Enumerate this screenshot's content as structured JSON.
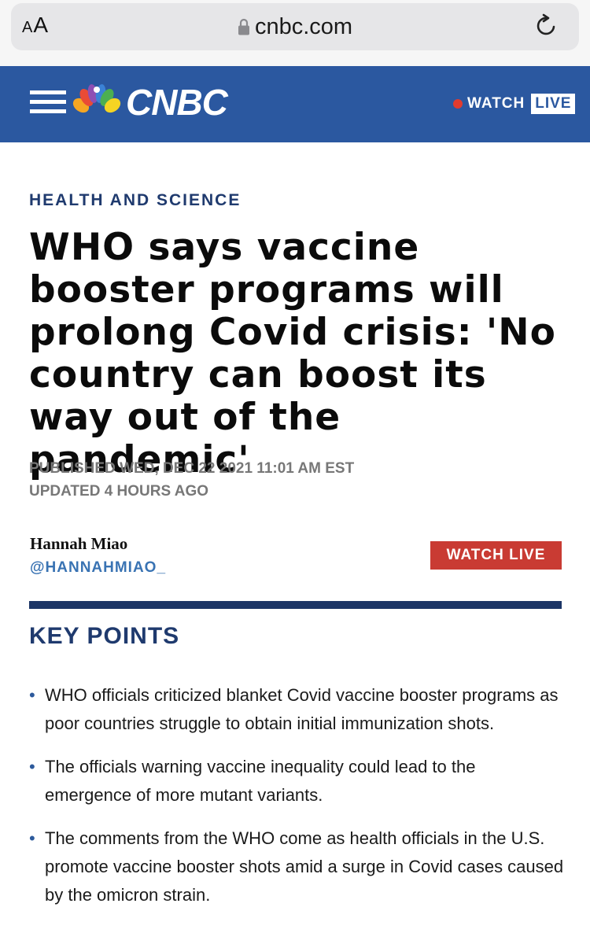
{
  "browser": {
    "text_size_label_small": "A",
    "text_size_label_large": "A",
    "url": "cnbc.com",
    "icons": [
      "lock-icon",
      "reload-icon"
    ]
  },
  "header": {
    "brand": "CNBC",
    "watch_label": "WATCH",
    "live_label": "LIVE",
    "brand_color": "#2b58a0",
    "icons": [
      "hamburger-menu-icon",
      "peacock-logo-icon"
    ]
  },
  "article": {
    "category": "HEALTH AND SCIENCE",
    "headline": "WHO says vaccine booster programs will prolong Covid crisis: 'No country can boost its way out of the pandemic'",
    "published": "PUBLISHED WED, DEC 22 2021 11:01 AM EST",
    "updated": "UPDATED 4 HOURS AGO",
    "author_name": "Hannah Miao",
    "author_handle": "@HANNAHMIAO_",
    "watch_live_button": "WATCH LIVE",
    "key_points_title": "KEY POINTS",
    "key_points": [
      "WHO officials criticized blanket Covid vaccine booster programs as poor countries struggle to obtain initial immunization shots.",
      "The officials warning vaccine inequality could lead to the emergence of more mutant variants.",
      "The comments from the WHO come as health officials in the U.S. promote vaccine booster shots amid a surge in Covid cases caused by the omicron strain."
    ],
    "accent_color": "#1f3a6e",
    "button_color": "#c93b33"
  }
}
